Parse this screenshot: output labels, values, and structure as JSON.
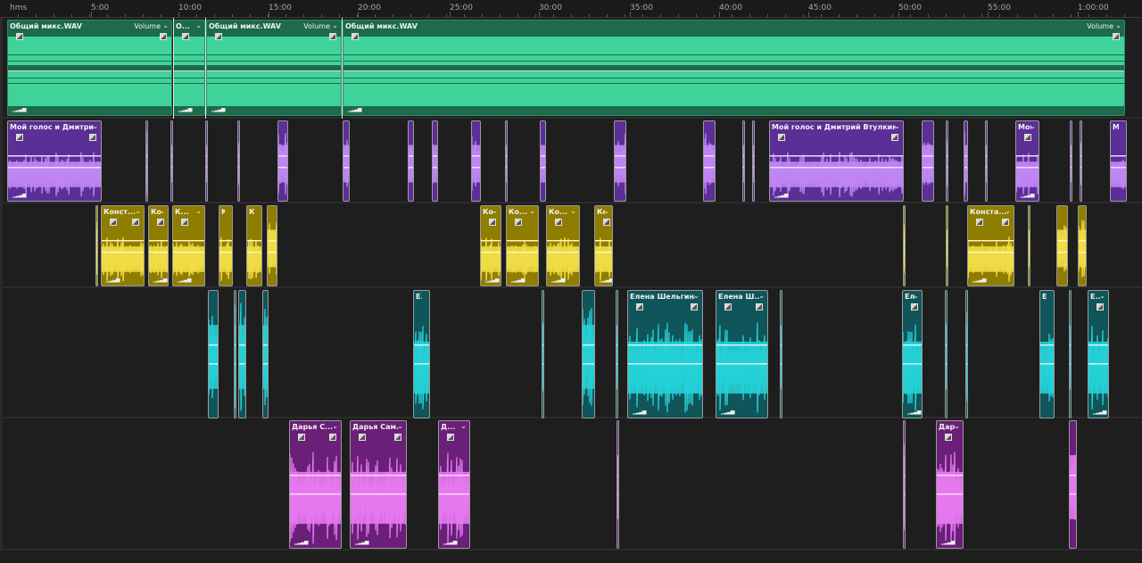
{
  "ruler": {
    "unit": "hms",
    "labels": [
      "5:00",
      "10:00",
      "15:00",
      "20:00",
      "25:00",
      "30:00",
      "35:00",
      "40:00",
      "45:00",
      "50:00",
      "55:00",
      "1:00:00"
    ]
  },
  "tracks": [
    {
      "name": "mix-track",
      "wave_color": "#3fd39a",
      "clip_bg": "#1d6a4c",
      "line_color": "#c9f2df",
      "clips": [
        {
          "label": "Общий микс.WAV",
          "volume": "Volume"
        },
        {
          "label": "О...",
          "volume": ""
        },
        {
          "label": "Общий микс.WAV",
          "volume": "Volume"
        },
        {
          "label": "Общий микс.WAV",
          "volume": "Volume"
        }
      ]
    },
    {
      "name": "purple-track",
      "wave_color": "#c085f5",
      "clip_bg": "#5b2f96",
      "line_color": "#eadcff",
      "clips": [
        {
          "label": "Мой голос и Дмитрий ..."
        },
        {
          "label": "Мой голос и Дмитрий Втулкин.WAV ..."
        },
        {
          "label": "Мой"
        },
        {
          "label": "М"
        }
      ]
    },
    {
      "name": "yellow-track",
      "wave_color": "#f0dc45",
      "clip_bg": "#8f7d00",
      "line_color": "#fff6b0",
      "clips": [
        {
          "label": "Конст..."
        },
        {
          "label": "Ко..."
        },
        {
          "label": "К..."
        },
        {
          "label": "К..."
        },
        {
          "label": "К..."
        },
        {
          "label": "Ко..."
        },
        {
          "label": "Ко..."
        },
        {
          "label": "Ко..."
        },
        {
          "label": "Ко..."
        },
        {
          "label": "Конста..."
        }
      ]
    },
    {
      "name": "cyan-track",
      "wave_color": "#25d0d6",
      "clip_bg": "#0f5559",
      "line_color": "#c8f7f8",
      "clips": [
        {
          "label": "Е..."
        },
        {
          "label": "Елена Шельгина..."
        },
        {
          "label": "Елена Ш..."
        },
        {
          "label": "Ел..."
        },
        {
          "label": "Е..."
        },
        {
          "label": "Е..."
        }
      ]
    },
    {
      "name": "pink-track",
      "wave_color": "#e678f0",
      "clip_bg": "#6a1f78",
      "line_color": "#f8d8fb",
      "clips": [
        {
          "label": "Дарья С..."
        },
        {
          "label": "Дарья Сам..."
        },
        {
          "label": "Д..."
        },
        {
          "label": "Дарья..."
        }
      ]
    }
  ]
}
